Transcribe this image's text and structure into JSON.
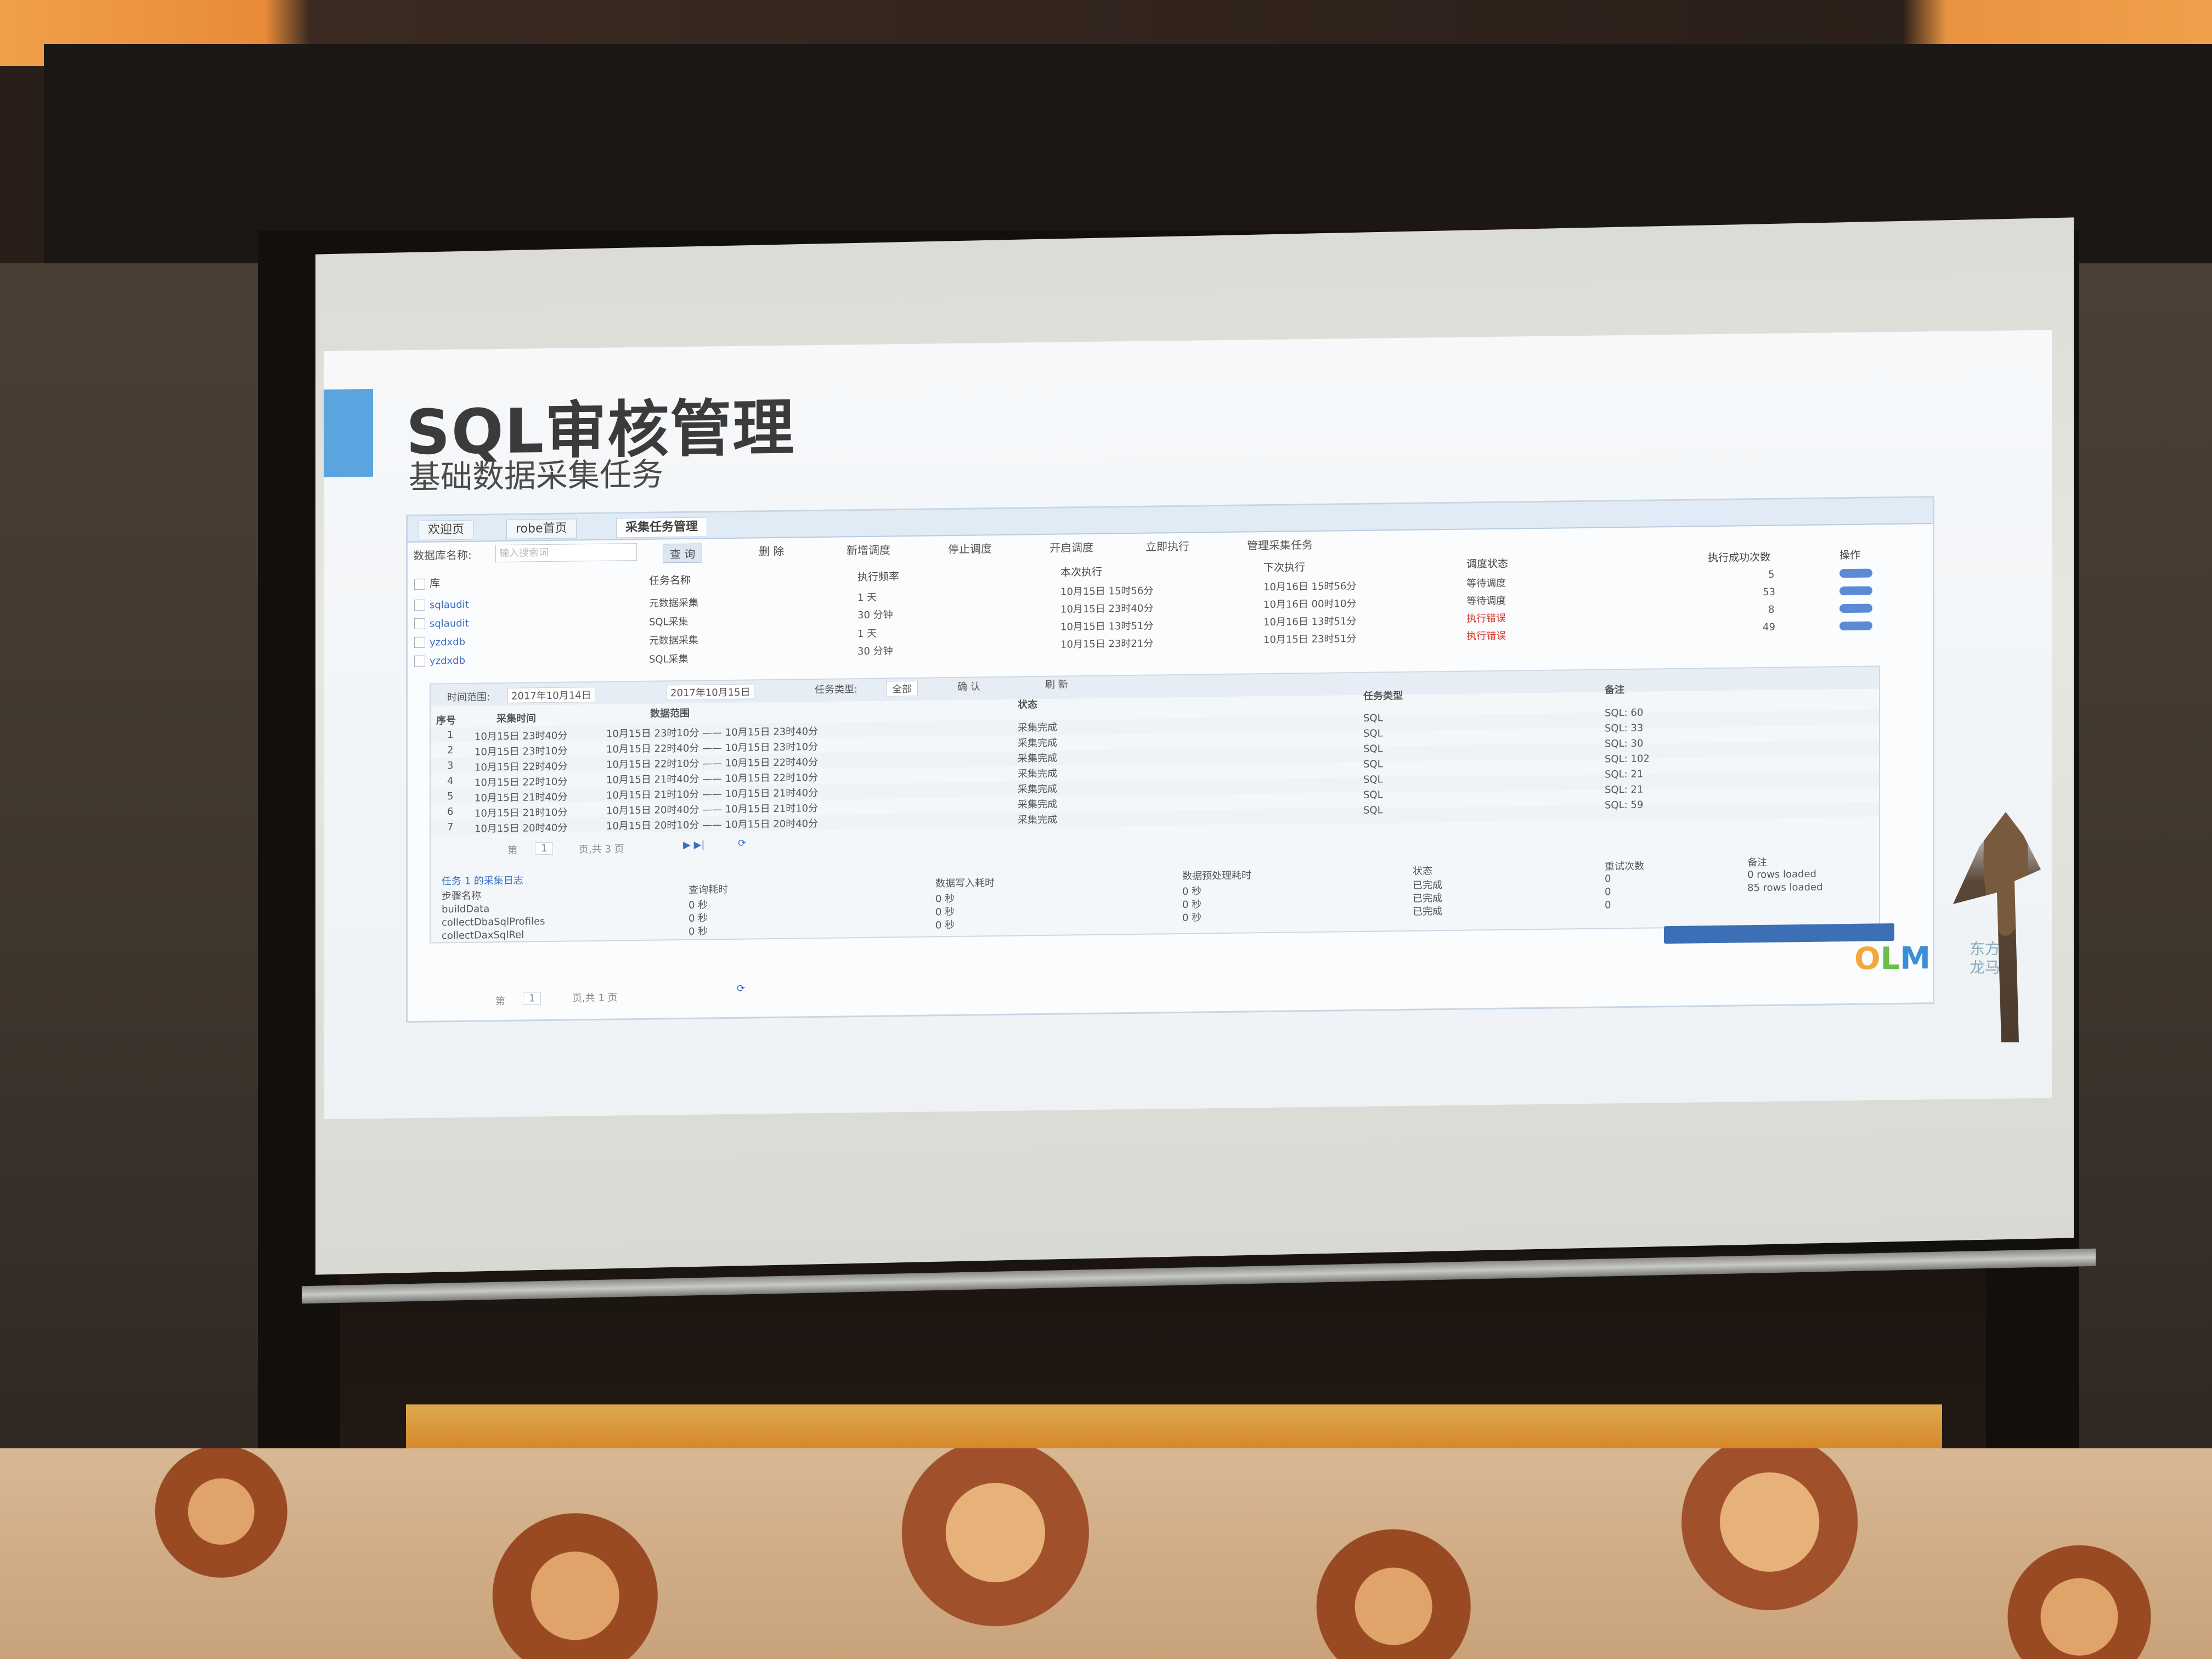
{
  "slide": {
    "title": "SQL审核管理",
    "subtitle": "基础数据采集任务"
  },
  "app": {
    "tabs": [
      "欢迎页",
      "robe首页",
      "采集任务管理"
    ],
    "toolbar": {
      "db_name_label": "数据库名称:",
      "search_placeholder": "输入搜索词",
      "query_button": "查 询",
      "delete_button": "删 除",
      "add_schedule": "新增调度",
      "stop_schedule": "停止调度",
      "start_schedule": "开启调度",
      "run_now": "立即执行",
      "manage_tasks": "管理采集任务"
    },
    "task_table": {
      "headers": [
        "库",
        "任务名称",
        "执行频率",
        "本次执行",
        "下次执行",
        "调度状态",
        "执行成功次数",
        "操作"
      ],
      "rows": [
        {
          "db": "",
          "task": "",
          "freq": "1 天",
          "this_run": "10月15日 15时56分",
          "next_run": "10月16日 15时56分",
          "status": "等待调度",
          "success": "5"
        },
        {
          "db": "sqlaudit",
          "task": "元数据采集",
          "freq": "30 分钟",
          "this_run": "10月15日 23时40分",
          "next_run": "10月16日 00时10分",
          "status": "等待调度",
          "success": "53"
        },
        {
          "db": "sqlaudit",
          "task": "SQL采集",
          "freq": "1 天",
          "this_run": "10月15日 13时51分",
          "next_run": "10月16日 13时51分",
          "status": "执行错误",
          "success": "8"
        },
        {
          "db": "yzdxdb",
          "task": "元数据采集",
          "freq": "30 分钟",
          "this_run": "10月15日 23时21分",
          "next_run": "10月15日 23时51分",
          "status": "执行错误",
          "success": "49"
        },
        {
          "db": "yzdxdb",
          "task": "SQL采集",
          "freq": "",
          "this_run": "",
          "next_run": "",
          "status": "",
          "success": ""
        }
      ]
    },
    "sub_panel": {
      "time_range_label": "时间范围:",
      "date_from": "2017年10月14日",
      "date_to": "2017年10月15日",
      "task_type_label": "任务类型:",
      "task_type_value": "全部",
      "confirm": "确 认",
      "refresh": "刷 新",
      "headers": [
        "序号",
        "采集时间",
        "数据范围",
        "状态",
        "任务类型",
        "备注"
      ],
      "rows": [
        {
          "n": "1",
          "time": "10月15日 23时40分",
          "range": "10月15日 23时10分 —— 10月15日 23时40分",
          "status": "采集完成",
          "type": "SQL",
          "note": "SQL: 60"
        },
        {
          "n": "2",
          "time": "10月15日 23时10分",
          "range": "10月15日 22时40分 —— 10月15日 23时10分",
          "status": "采集完成",
          "type": "SQL",
          "note": "SQL: 33"
        },
        {
          "n": "3",
          "time": "10月15日 22时40分",
          "range": "10月15日 22时10分 —— 10月15日 22时40分",
          "status": "采集完成",
          "type": "SQL",
          "note": "SQL: 30"
        },
        {
          "n": "4",
          "time": "10月15日 22时10分",
          "range": "10月15日 21时40分 —— 10月15日 22时10分",
          "status": "采集完成",
          "type": "SQL",
          "note": "SQL: 102"
        },
        {
          "n": "5",
          "time": "10月15日 21时40分",
          "range": "10月15日 21时10分 —— 10月15日 21时40分",
          "status": "采集完成",
          "type": "SQL",
          "note": "SQL: 21"
        },
        {
          "n": "6",
          "time": "10月15日 21时10分",
          "range": "10月15日 20时40分 —— 10月15日 21时10分",
          "status": "采集完成",
          "type": "SQL",
          "note": "SQL: 21"
        },
        {
          "n": "7",
          "time": "10月15日 20时40分",
          "range": "10月15日 20时10分 —— 10月15日 20时40分",
          "status": "采集完成",
          "type": "SQL",
          "note": "SQL: 59"
        }
      ],
      "pager_page_label": "第",
      "pager_page": "1",
      "pager_total": "页,共 3 页"
    },
    "step_panel": {
      "title": "任务 1 的采集日志",
      "headers": [
        "步骤名称",
        "查询耗时",
        "数据写入耗时",
        "数据预处理耗时",
        "状态",
        "重试次数",
        "备注"
      ],
      "rows": [
        {
          "step": "buildData",
          "q": "0 秒",
          "w": "0 秒",
          "p": "0 秒",
          "status": "已完成",
          "retry": "0",
          "note": "0 rows loaded"
        },
        {
          "step": "collectDbaSqlProfiles",
          "q": "0 秒",
          "w": "0 秒",
          "p": "0 秒",
          "status": "已完成",
          "retry": "0",
          "note": "85 rows loaded"
        },
        {
          "step": "collectDaxSqlRel",
          "q": "0 秒",
          "w": "0 秒",
          "p": "0 秒",
          "status": "已完成",
          "retry": "0",
          "note": ""
        }
      ]
    },
    "bottom_pager": {
      "page_label": "第",
      "page": "1",
      "total": "页,共 1 页"
    }
  },
  "branding": {
    "logo": "OLM",
    "logo_sub_1": "东方",
    "logo_sub_2": "龙马"
  }
}
